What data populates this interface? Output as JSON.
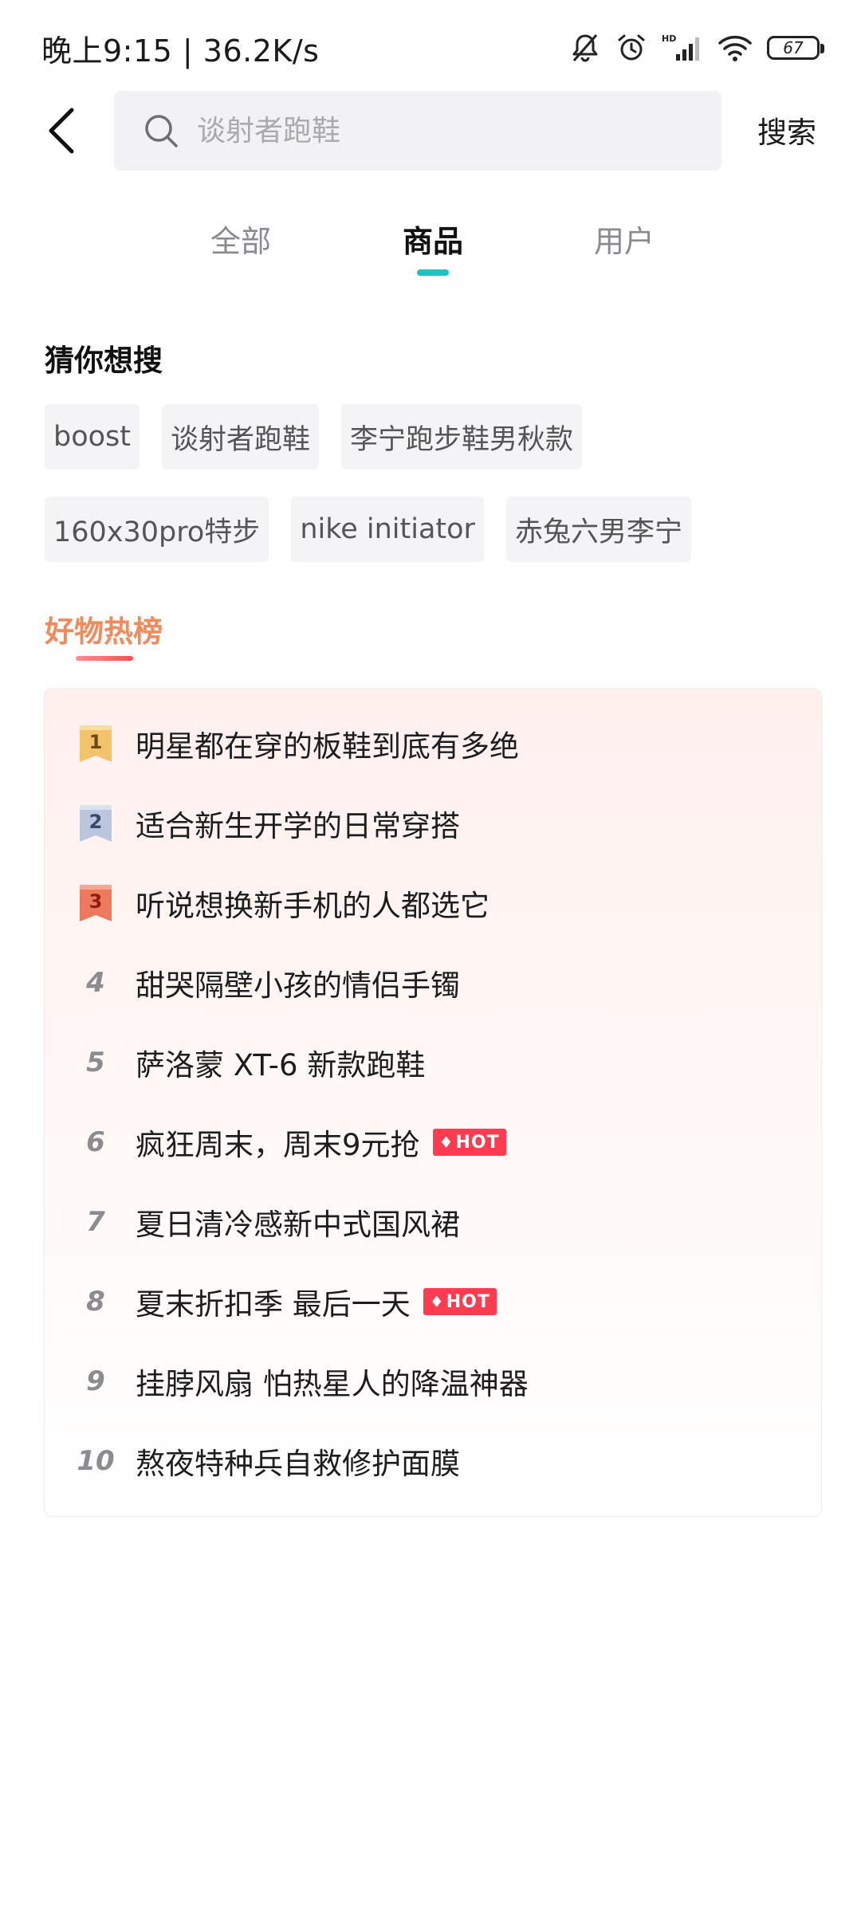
{
  "status_bar": {
    "time_speed": "晚上9:15 | 36.2K/s",
    "battery": "67",
    "icons": [
      "mute-bell-icon",
      "alarm-icon",
      "hd-signal-icon",
      "wifi-icon",
      "battery-icon"
    ]
  },
  "search": {
    "placeholder": "谈射者跑鞋",
    "submit_label": "搜索"
  },
  "tabs": [
    {
      "label": "全部",
      "active": false
    },
    {
      "label": "商品",
      "active": true
    },
    {
      "label": "用户",
      "active": false
    }
  ],
  "guess": {
    "title": "猜你想搜",
    "rows": [
      [
        "boost",
        "谈射者跑鞋",
        "李宁跑步鞋男秋款"
      ],
      [
        "160x30pro特步",
        "nike initiator",
        "赤兔六男李宁"
      ]
    ]
  },
  "hot_list": {
    "title": "好物热榜",
    "items": [
      {
        "rank": "1",
        "text": "明星都在穿的板鞋到底有多绝",
        "badge": ""
      },
      {
        "rank": "2",
        "text": "适合新生开学的日常穿搭",
        "badge": ""
      },
      {
        "rank": "3",
        "text": "听说想换新手机的人都选它",
        "badge": ""
      },
      {
        "rank": "4",
        "text": "甜哭隔壁小孩的情侣手镯",
        "badge": ""
      },
      {
        "rank": "5",
        "text": "萨洛蒙 XT-6 新款跑鞋",
        "badge": ""
      },
      {
        "rank": "6",
        "text": "疯狂周末，周末9元抢",
        "badge": "HOT"
      },
      {
        "rank": "7",
        "text": "夏日清冷感新中式国风裙",
        "badge": ""
      },
      {
        "rank": "8",
        "text": "夏末折扣季 最后一天",
        "badge": "HOT"
      },
      {
        "rank": "9",
        "text": "挂脖风扇 怕热星人的降温神器",
        "badge": ""
      },
      {
        "rank": "10",
        "text": "熬夜特种兵自救修护面膜",
        "badge": ""
      }
    ],
    "medal_colors": [
      "#f3c36b",
      "#b9c6dc",
      "#ee7a5d"
    ]
  }
}
